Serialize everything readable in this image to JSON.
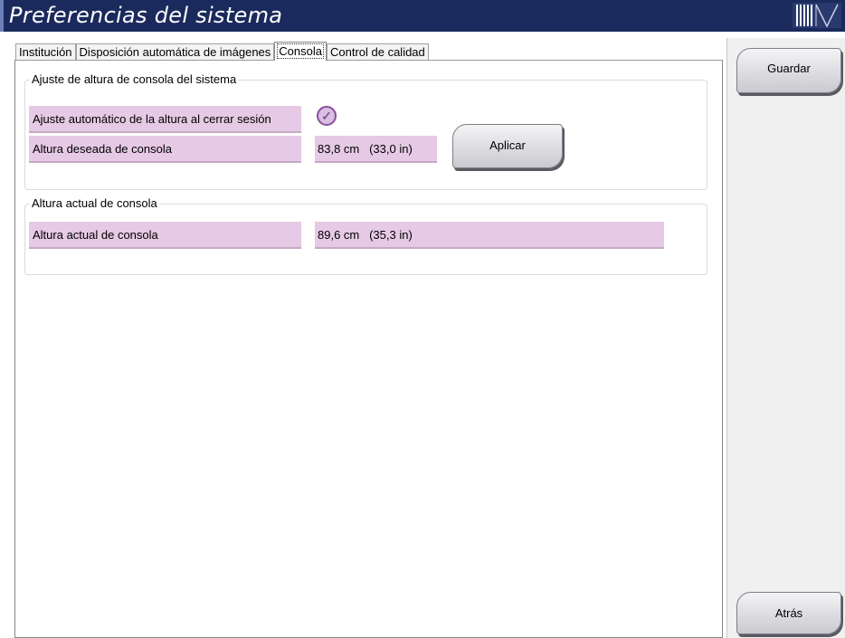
{
  "window": {
    "title": "Preferencias del sistema"
  },
  "tabs": [
    {
      "label": "Institución"
    },
    {
      "label": "Disposición automática de imágenes"
    },
    {
      "label": "Consola"
    },
    {
      "label": "Control de calidad"
    }
  ],
  "group_height": {
    "title": "Ajuste de altura de consola del sistema",
    "auto_adjust_label": "Ajuste automático de la altura al cerrar sesión",
    "auto_adjust_checked": true,
    "desired_label": "Altura deseada de consola",
    "desired_value": "83,8 cm   (33,0 in)",
    "apply_label": "Aplicar"
  },
  "group_current": {
    "title": "Altura actual de consola",
    "current_label": "Altura actual de consola",
    "current_value": "89,6 cm   (35,3 in)"
  },
  "side": {
    "save_label": "Guardar",
    "back_label": "Atrás"
  },
  "colors": {
    "titlebar": "#1b2a5c",
    "field_bg": "#e6c9e4",
    "check_accent": "#8a4f9a"
  }
}
